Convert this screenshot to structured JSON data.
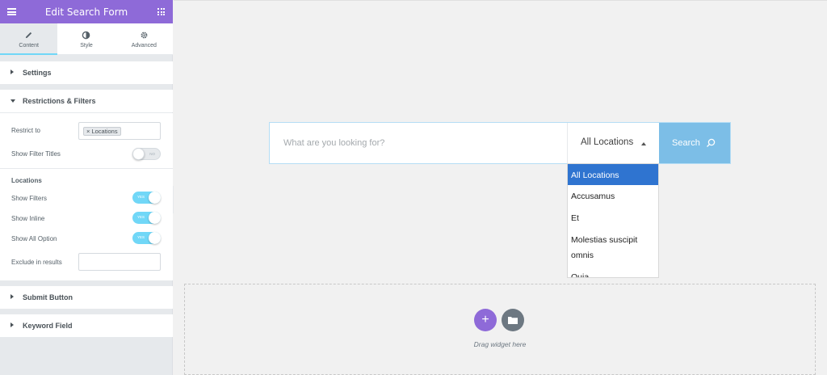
{
  "header": {
    "title": "Edit Search Form"
  },
  "tabs": [
    {
      "label": "Content",
      "icon": "pencil-icon",
      "active": true
    },
    {
      "label": "Style",
      "icon": "half-circle-icon",
      "active": false
    },
    {
      "label": "Advanced",
      "icon": "gear-icon",
      "active": false
    }
  ],
  "sections": {
    "settings": "Settings",
    "restrictions": "Restrictions & Filters",
    "submit": "Submit Button",
    "keyword": "Keyword Field"
  },
  "restrictions": {
    "restrict_to_label": "Restrict to",
    "restrict_chip": "× Locations",
    "show_filter_titles_label": "Show Filter Titles",
    "show_filter_titles_toggle": "NO",
    "locations_title": "Locations",
    "show_filters_label": "Show Filters",
    "show_filters_toggle": "YES",
    "show_inline_label": "Show Inline",
    "show_inline_toggle": "YES",
    "show_all_option_label": "Show All Option",
    "show_all_option_toggle": "YES",
    "exclude_label": "Exclude in results",
    "exclude_value": ""
  },
  "canvas": {
    "search_placeholder": "What are you looking for?",
    "location_value": "All Locations",
    "search_button": "Search",
    "dropdown_items": [
      "All Locations",
      "Accusamus",
      "Et",
      "Molestias suscipit omnis",
      "Quia"
    ],
    "drag_text": "Drag widget here",
    "add_symbol": "+"
  },
  "colors": {
    "accent_purple": "#8e6ad8",
    "toggle_on": "#71d7f7",
    "search_button": "#7cbee7",
    "dropdown_selected": "#2f74d0"
  }
}
